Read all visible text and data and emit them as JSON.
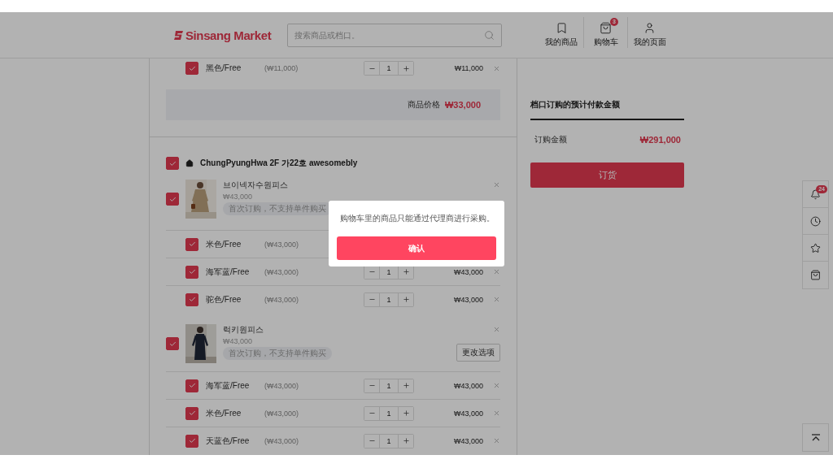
{
  "header": {
    "logo": "Sinsang Market",
    "search": {
      "placeholder": "搜索商品或档口。"
    },
    "nav": [
      {
        "label": "我的商品"
      },
      {
        "label": "购物车",
        "badge": "3"
      },
      {
        "label": "我的页面"
      }
    ]
  },
  "cart": {
    "top_variant": {
      "checked": true,
      "option": "黑色/Free",
      "unit_price": "(₩11,000)",
      "quantity": "1",
      "total": "₩11,000"
    },
    "subtotal": {
      "label": "商品价格",
      "amount": "₩33,000"
    },
    "store": {
      "checked": true,
      "name": "ChungPyungHwa 2F 가22호 awesomebly",
      "products": [
        {
          "checked": true,
          "name": "브이넥자수원피스",
          "price": "₩43,000",
          "notice": "首次订购，不支持单件购买",
          "variants": [
            {
              "checked": true,
              "option": "米色/Free",
              "unit_price": "(₩43,000)"
            },
            {
              "checked": true,
              "option": "海军蓝/Free",
              "unit_price": "(₩43,000)",
              "quantity": "1",
              "total": "₩43,000"
            },
            {
              "checked": true,
              "option": "驼色/Free",
              "unit_price": "(₩43,000)",
              "quantity": "1",
              "total": "₩43,000"
            }
          ]
        },
        {
          "checked": true,
          "name": "럭키원피스",
          "price": "₩43,000",
          "notice": "首次订购，不支持单件购买",
          "option_button": "更改选项",
          "variants": [
            {
              "checked": true,
              "option": "海军蓝/Free",
              "unit_price": "(₩43,000)",
              "quantity": "1",
              "total": "₩43,000"
            },
            {
              "checked": true,
              "option": "米色/Free",
              "unit_price": "(₩43,000)",
              "quantity": "1",
              "total": "₩43,000"
            },
            {
              "checked": true,
              "option": "天蓝色/Free",
              "unit_price": "(₩43,000)",
              "quantity": "1",
              "total": "₩43,000"
            }
          ]
        }
      ]
    }
  },
  "summary": {
    "title": "档口订购的预计付款金额",
    "label": "订购金额",
    "amount": "₩291,000",
    "order_button": "订货"
  },
  "quick_bar": {
    "notification_badge": "24"
  },
  "dialog": {
    "message": "购物车里的商品只能通过代理商进行采购。",
    "confirm": "确认"
  }
}
